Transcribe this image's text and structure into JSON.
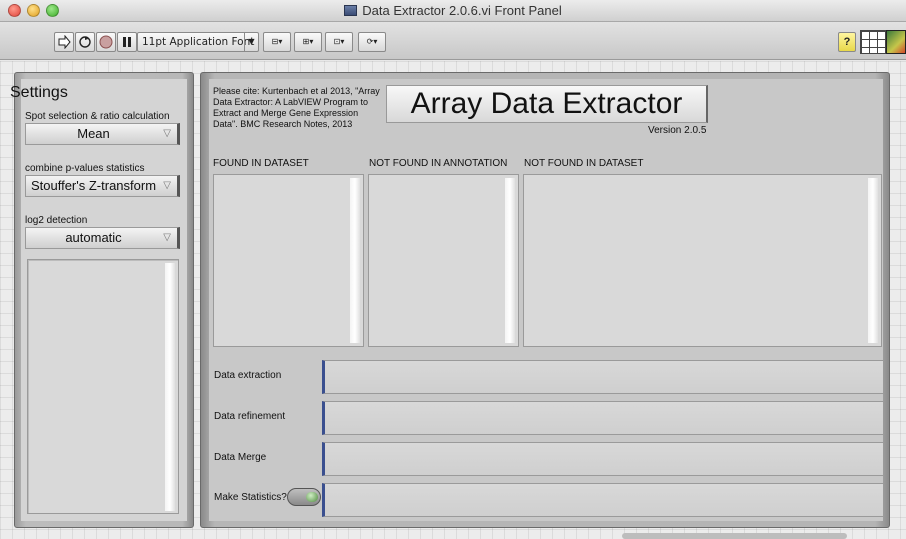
{
  "window": {
    "title": "Data Extractor 2.0.6.vi Front Panel"
  },
  "toolbar": {
    "run_icon": "run-arrow-icon",
    "run_continuous_icon": "run-continuously-icon",
    "abort_icon": "abort-icon",
    "pause_icon": "pause-icon",
    "font_label": "11pt Application Font",
    "align_icon": "align-objects-icon",
    "distribute_icon": "distribute-objects-icon",
    "resize_icon": "resize-objects-icon",
    "reorder_icon": "reorder-icon",
    "help_label": "?"
  },
  "settings": {
    "title": "Settings",
    "spot_label": "Spot selection & ratio calculation",
    "spot_value": "Mean",
    "pvalue_label": "combine p-values statistics",
    "pvalue_value": "Stouffer's Z-transform",
    "log2_label": "log2 detection",
    "log2_value": "automatic"
  },
  "main": {
    "citation": "Please cite: Kurtenbach et al 2013, \"Array Data Extractor: A LabVIEW Program to Extract and Merge Gene Expression Data\". BMC Research Notes, 2013",
    "title": "Array Data Extractor",
    "version": "Version 2.0.5",
    "col_found": "FOUND IN DATASET",
    "col_not_annot": "NOT FOUND IN ANNOTATION",
    "col_not_dataset": "NOT FOUND IN DATASET",
    "step_extraction": "Data extraction",
    "step_refinement": "Data refinement",
    "step_merge": "Data Merge",
    "step_statistics": "Make Statistics?"
  }
}
